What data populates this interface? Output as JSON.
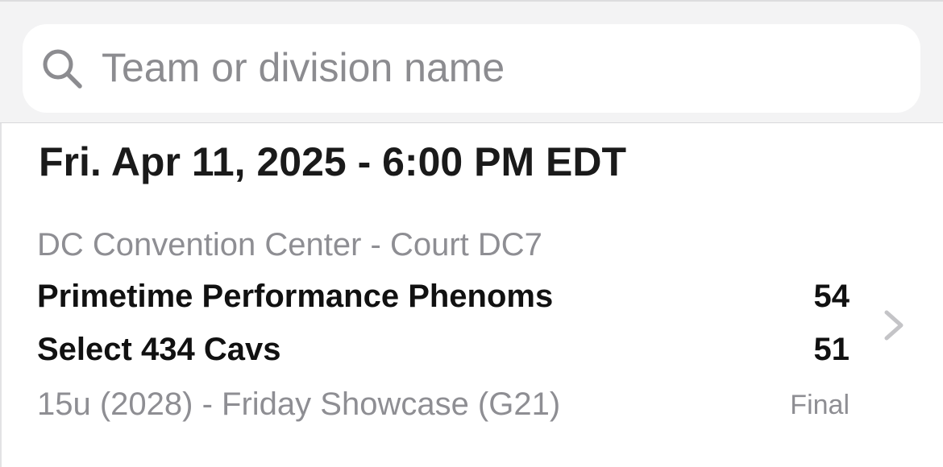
{
  "search": {
    "placeholder": "Team or division name",
    "icon": "search-icon"
  },
  "schedule": {
    "date_header": "Fri. Apr 11, 2025 - 6:00 PM EDT",
    "games": [
      {
        "venue": "DC Convention Center - Court DC7",
        "teams": [
          {
            "name": "Primetime Performance Phenoms",
            "score": "54"
          },
          {
            "name": "Select 434 Cavs",
            "score": "51"
          }
        ],
        "division": "15u (2028) - Friday Showcase (G21)",
        "status": "Final"
      }
    ]
  },
  "colors": {
    "header_background": "#f3f3f4",
    "secondary_text": "#8e8e93",
    "primary_text": "#111111"
  }
}
